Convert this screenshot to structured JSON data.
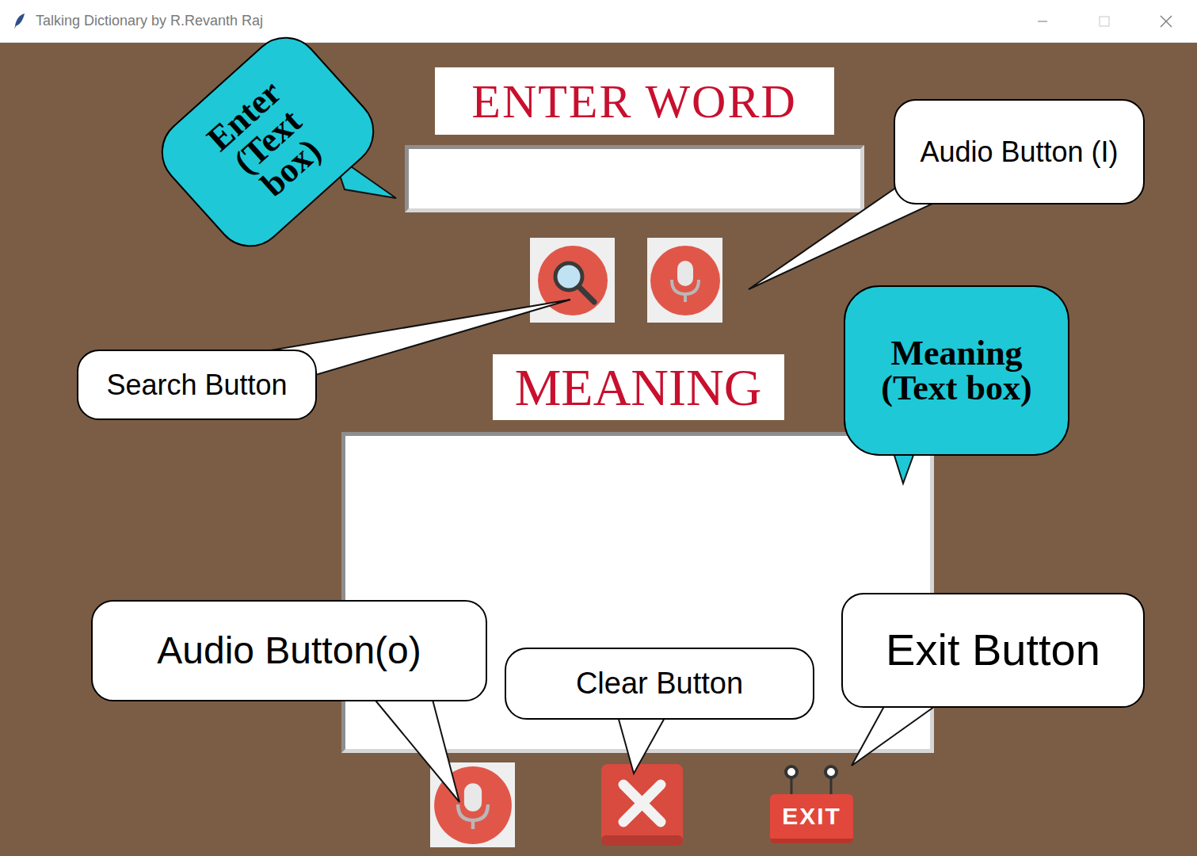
{
  "window": {
    "title": "Talking Dictionary by R.Revanth Raj"
  },
  "labels": {
    "enter_word": "ENTER WORD",
    "meaning": "MEANING"
  },
  "exit_button": {
    "label": "EXIT"
  },
  "callouts": [
    {
      "text": "Enter (Text box)",
      "kind": "bubble"
    },
    {
      "text": "Audio Button (I)",
      "kind": "note"
    },
    {
      "text": "Search Button",
      "kind": "note"
    },
    {
      "text": "Meaning (Text box)",
      "kind": "bubble"
    },
    {
      "text": "Audio Button(o)",
      "kind": "note"
    },
    {
      "text": "Clear Button",
      "kind": "note"
    },
    {
      "text": "Exit Button",
      "kind": "note"
    }
  ]
}
